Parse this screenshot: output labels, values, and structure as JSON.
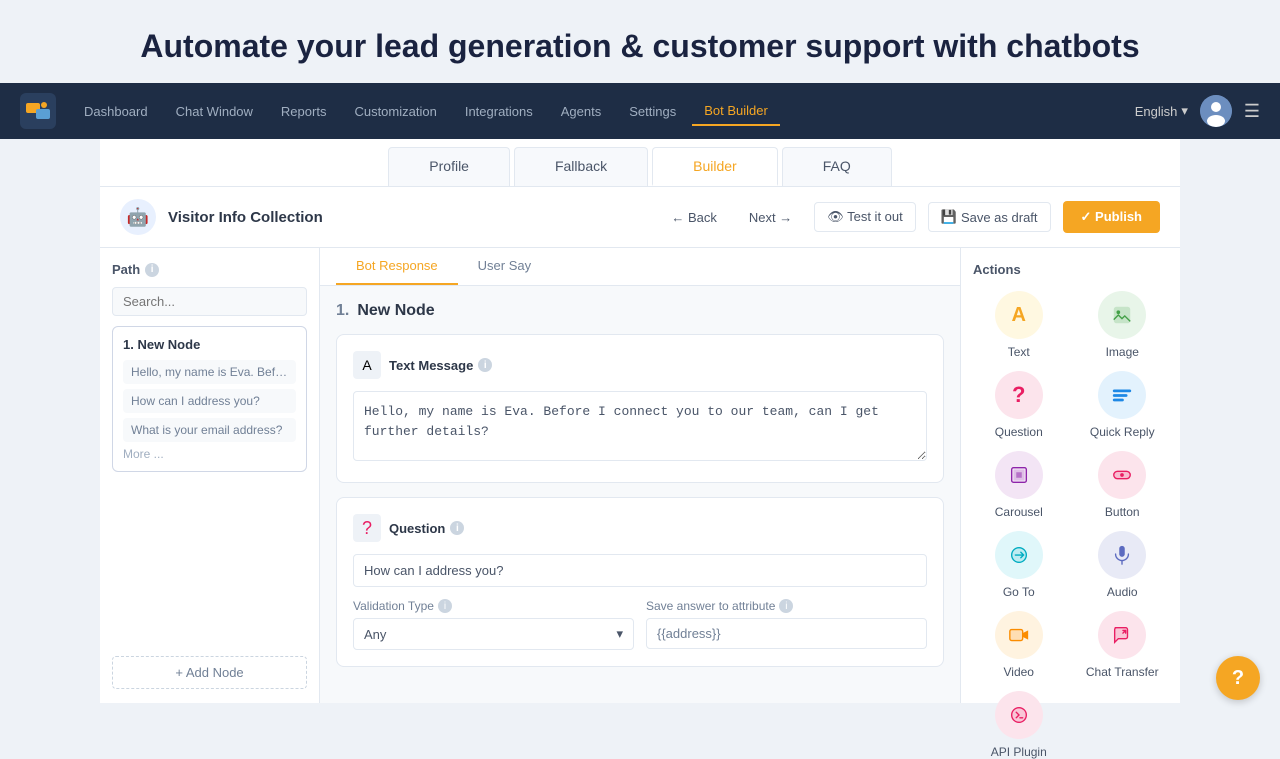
{
  "hero": {
    "title": "Automate your lead generation & customer support with chatbots"
  },
  "navbar": {
    "logo_alt": "chatbot-logo",
    "items": [
      {
        "label": "Dashboard",
        "active": false
      },
      {
        "label": "Chat Window",
        "active": false
      },
      {
        "label": "Reports",
        "active": false
      },
      {
        "label": "Customization",
        "active": false
      },
      {
        "label": "Integrations",
        "active": false
      },
      {
        "label": "Agents",
        "active": false
      },
      {
        "label": "Settings",
        "active": false
      },
      {
        "label": "Bot Builder",
        "active": true
      }
    ],
    "language": "English",
    "menu_icon": "☰"
  },
  "tabs": [
    {
      "label": "Profile",
      "active": false
    },
    {
      "label": "Fallback",
      "active": false
    },
    {
      "label": "Builder",
      "active": true
    },
    {
      "label": "FAQ",
      "active": false
    }
  ],
  "builder_header": {
    "bot_icon": "🤖",
    "bot_title": "Visitor Info Collection",
    "back_label": "← Back",
    "next_label": "Next →",
    "test_label": "👁 Test it out",
    "draft_label": "Save as draft",
    "publish_label": "✓ Publish"
  },
  "left_panel": {
    "title": "Path",
    "search_placeholder": "Search...",
    "path_card": {
      "title": "1. New Node",
      "items": [
        "Hello, my name is Eva. Before I c...",
        "How can I address you?",
        "What is your email address?"
      ],
      "more": "More ..."
    },
    "add_node_label": "+ Add Node"
  },
  "response_tabs": [
    {
      "label": "Bot Response",
      "active": true
    },
    {
      "label": "User Say",
      "active": false
    }
  ],
  "node": {
    "number": "1.",
    "title": "New Node"
  },
  "text_message": {
    "label": "Text Message",
    "value": "Hello, my name is Eva. Before I connect you to our team, can I get further details?"
  },
  "question": {
    "label": "Question",
    "value": "How can I address you?",
    "validation_label": "Validation Type",
    "validation_value": "Any",
    "attribute_label": "Save answer to attribute",
    "attribute_value": "{{address}}"
  },
  "actions": {
    "title": "Actions",
    "items": [
      {
        "label": "Text",
        "icon": "A",
        "color_class": "icon-text"
      },
      {
        "label": "Image",
        "icon": "🖼",
        "color_class": "icon-image"
      },
      {
        "label": "Question",
        "icon": "?",
        "color_class": "icon-question"
      },
      {
        "label": "Quick Reply",
        "icon": "≡",
        "color_class": "icon-quickreply"
      },
      {
        "label": "Carousel",
        "icon": "⊞",
        "color_class": "icon-carousel"
      },
      {
        "label": "Button",
        "icon": "⊕",
        "color_class": "icon-button"
      },
      {
        "label": "Go To",
        "icon": "↺",
        "color_class": "icon-goto"
      },
      {
        "label": "Audio",
        "icon": "🎤",
        "color_class": "icon-audio"
      },
      {
        "label": "Video",
        "icon": "📹",
        "color_class": "icon-video"
      },
      {
        "label": "Chat Transfer",
        "icon": "💬",
        "color_class": "icon-chattransfer"
      },
      {
        "label": "API Plugin",
        "icon": "🔌",
        "color_class": "icon-apiplugin"
      }
    ]
  },
  "help_btn": "?"
}
